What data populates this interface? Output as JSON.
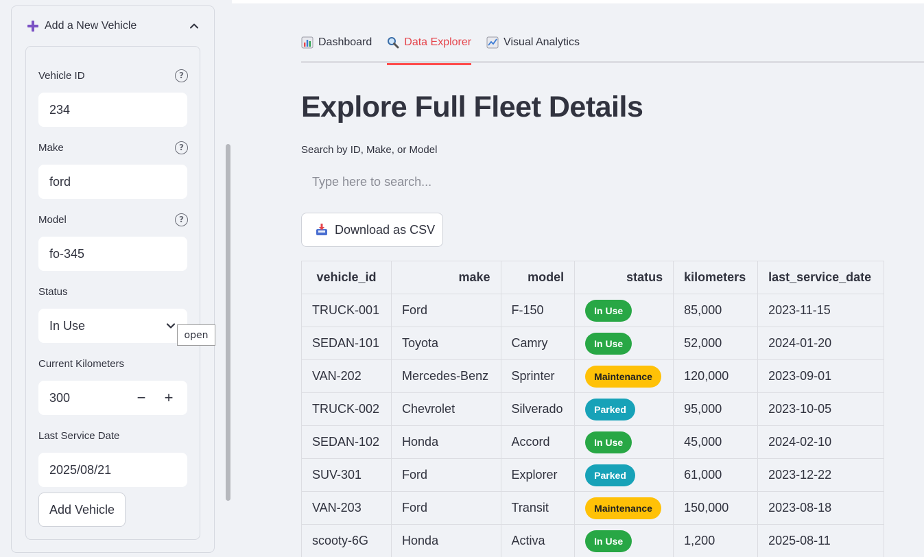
{
  "sidebar": {
    "expander_title": "Add a New Vehicle",
    "fields": {
      "vehicle_id": {
        "label": "Vehicle ID",
        "value": "234"
      },
      "make": {
        "label": "Make",
        "value": "ford"
      },
      "model": {
        "label": "Model",
        "value": "fo-345"
      },
      "status": {
        "label": "Status",
        "value": "In Use"
      },
      "kilometers": {
        "label": "Current Kilometers",
        "value": "300",
        "minus": "−",
        "plus": "+"
      },
      "service_date": {
        "label": "Last Service Date",
        "value": "2025/08/21"
      }
    },
    "help_glyph": "?",
    "add_button": "Add Vehicle",
    "tooltip": "open"
  },
  "tabs": [
    {
      "label": "Dashboard",
      "icon": "bar-chart-icon",
      "active": false
    },
    {
      "label": "Data Explorer",
      "icon": "magnifier-icon",
      "active": true
    },
    {
      "label": "Visual Analytics",
      "icon": "line-chart-icon",
      "active": false
    }
  ],
  "main": {
    "title": "Explore Full Fleet Details",
    "search_label": "Search by ID, Make, or Model",
    "search_placeholder": "Type here to search...",
    "download_button": "Download as CSV"
  },
  "table": {
    "columns": [
      "vehicle_id",
      "make",
      "model",
      "status",
      "kilometers",
      "last_service_date"
    ],
    "rows": [
      [
        "TRUCK-001",
        "Ford",
        "F-150",
        "In Use",
        "85,000",
        "2023-11-15"
      ],
      [
        "SEDAN-101",
        "Toyota",
        "Camry",
        "In Use",
        "52,000",
        "2024-01-20"
      ],
      [
        "VAN-202",
        "Mercedes-Benz",
        "Sprinter",
        "Maintenance",
        "120,000",
        "2023-09-01"
      ],
      [
        "TRUCK-002",
        "Chevrolet",
        "Silverado",
        "Parked",
        "95,000",
        "2023-10-05"
      ],
      [
        "SEDAN-102",
        "Honda",
        "Accord",
        "In Use",
        "45,000",
        "2024-02-10"
      ],
      [
        "SUV-301",
        "Ford",
        "Explorer",
        "Parked",
        "61,000",
        "2023-12-22"
      ],
      [
        "VAN-203",
        "Ford",
        "Transit",
        "Maintenance",
        "150,000",
        "2023-08-18"
      ],
      [
        "scooty-6G",
        "Honda",
        "Activa",
        "In Use",
        "1,200",
        "2025-08-11"
      ]
    ]
  },
  "colors": {
    "accent": "#ff4b4b",
    "in_use": "#28a745",
    "maintenance": "#ffc107",
    "parked": "#17a2b8"
  }
}
